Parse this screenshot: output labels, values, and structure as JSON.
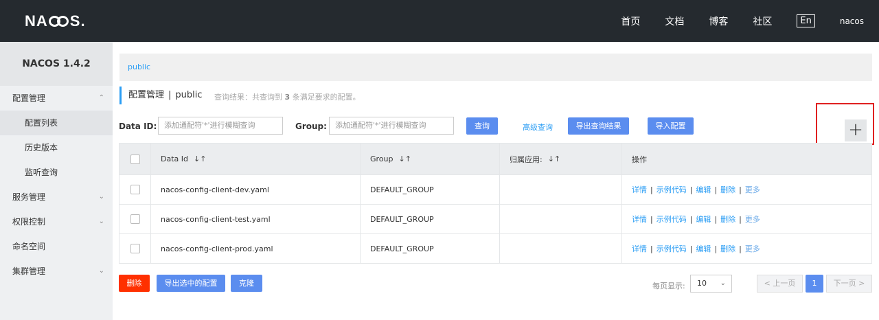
{
  "header": {
    "logo": "NACOS.",
    "nav": [
      "首页",
      "文档",
      "博客",
      "社区"
    ],
    "lang": "En",
    "user": "nacos"
  },
  "sidebar": {
    "version": "NACOS 1.4.2",
    "config_group": "配置管理",
    "config_items": [
      "配置列表",
      "历史版本",
      "监听查询"
    ],
    "service_group": "服务管理",
    "auth_group": "权限控制",
    "namespace": "命名空间",
    "cluster_group": "集群管理"
  },
  "main": {
    "namespace_link": "public",
    "title": "配置管理",
    "title_sep": "|",
    "title_ns": "public",
    "result_prefix": "查询结果：共查询到",
    "result_count": "3",
    "result_suffix": "条满足要求的配置。",
    "search": {
      "data_id_label": "Data ID:",
      "data_id_placeholder": "添加通配符'*'进行模糊查询",
      "group_label": "Group:",
      "group_placeholder": "添加通配符'*'进行模糊查询",
      "query": "查询",
      "advanced": "高级查询",
      "export_results": "导出查询结果",
      "import": "导入配置",
      "add": "+"
    },
    "table": {
      "headers": [
        "Data Id",
        "Group",
        "归属应用:",
        "操作"
      ],
      "rows": [
        {
          "data_id": "nacos-config-client-dev.yaml",
          "group": "DEFAULT_GROUP",
          "app": ""
        },
        {
          "data_id": "nacos-config-client-test.yaml",
          "group": "DEFAULT_GROUP",
          "app": ""
        },
        {
          "data_id": "nacos-config-client-prod.yaml",
          "group": "DEFAULT_GROUP",
          "app": ""
        }
      ],
      "ops": [
        "详情",
        "示例代码",
        "编辑",
        "删除",
        "更多"
      ],
      "op_sep": "|"
    },
    "bottom": {
      "delete": "删除",
      "export_selected": "导出选中的配置",
      "clone": "克隆",
      "per_page_label": "每页显示:",
      "per_page_value": "10",
      "prev": "上一页",
      "page": "1",
      "next": "下一页"
    }
  },
  "colors": {
    "header_bg": "#252a2f",
    "accent": "#2a9df4",
    "button": "#5b8def",
    "danger": "#ff3000",
    "highlight": "#e02020"
  }
}
